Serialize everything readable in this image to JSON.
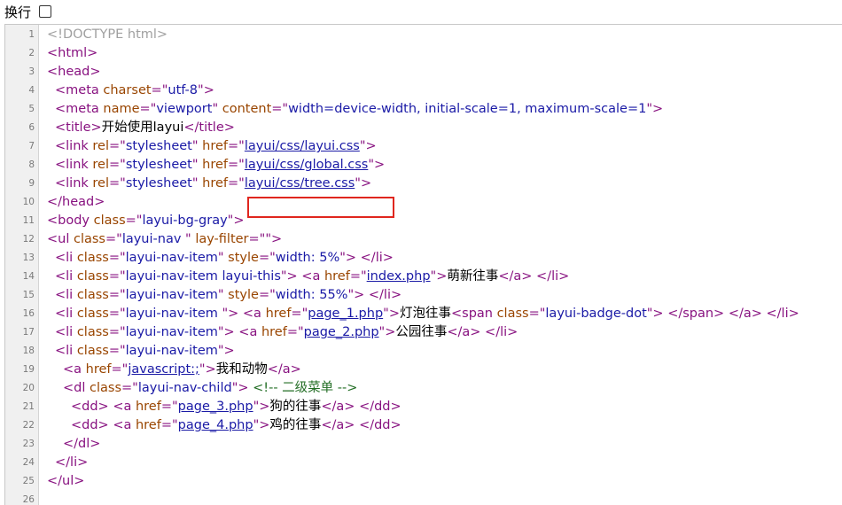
{
  "toolbar": {
    "wrap_label": "换行",
    "wrap_checked": false
  },
  "lines": [
    {
      "n": "1",
      "indent": 0,
      "parts": [
        {
          "t": "doctype",
          "v": "<!DOCTYPE html>"
        }
      ]
    },
    {
      "n": "2",
      "indent": 0,
      "parts": [
        {
          "t": "tag",
          "v": "<html>"
        }
      ]
    },
    {
      "n": "3",
      "indent": 0,
      "parts": [
        {
          "t": "tag",
          "v": "<head>"
        }
      ]
    },
    {
      "n": "4",
      "indent": 1,
      "parts": [
        {
          "t": "tag",
          "v": "<meta "
        },
        {
          "t": "attr",
          "v": "charset"
        },
        {
          "t": "tag",
          "v": "=\""
        },
        {
          "t": "val",
          "v": "utf-8"
        },
        {
          "t": "tag",
          "v": "\">"
        }
      ]
    },
    {
      "n": "5",
      "indent": 1,
      "parts": [
        {
          "t": "tag",
          "v": "<meta "
        },
        {
          "t": "attr",
          "v": "name"
        },
        {
          "t": "tag",
          "v": "=\""
        },
        {
          "t": "val",
          "v": "viewport"
        },
        {
          "t": "tag",
          "v": "\" "
        },
        {
          "t": "attr",
          "v": "content"
        },
        {
          "t": "tag",
          "v": "=\""
        },
        {
          "t": "val",
          "v": "width=device-width, initial-scale=1, maximum-scale=1"
        },
        {
          "t": "tag",
          "v": "\">"
        }
      ]
    },
    {
      "n": "6",
      "indent": 1,
      "parts": [
        {
          "t": "tag",
          "v": "<title>"
        },
        {
          "t": "text",
          "v": "开始使用layui"
        },
        {
          "t": "tag",
          "v": "</title>"
        }
      ]
    },
    {
      "n": "7",
      "indent": 1,
      "parts": [
        {
          "t": "tag",
          "v": "<link "
        },
        {
          "t": "attr",
          "v": "rel"
        },
        {
          "t": "tag",
          "v": "=\""
        },
        {
          "t": "val",
          "v": "stylesheet"
        },
        {
          "t": "tag",
          "v": "\" "
        },
        {
          "t": "attr",
          "v": "href"
        },
        {
          "t": "tag",
          "v": "=\""
        },
        {
          "t": "link",
          "v": "layui/css/layui.css"
        },
        {
          "t": "tag",
          "v": "\">"
        }
      ]
    },
    {
      "n": "8",
      "indent": 1,
      "parts": [
        {
          "t": "tag",
          "v": "<link "
        },
        {
          "t": "attr",
          "v": "rel"
        },
        {
          "t": "tag",
          "v": "=\""
        },
        {
          "t": "val",
          "v": "stylesheet"
        },
        {
          "t": "tag",
          "v": "\" "
        },
        {
          "t": "attr",
          "v": "href"
        },
        {
          "t": "tag",
          "v": "=\""
        },
        {
          "t": "link",
          "v": "layui/css/global.css"
        },
        {
          "t": "tag",
          "v": "\">"
        }
      ]
    },
    {
      "n": "9",
      "indent": 1,
      "parts": [
        {
          "t": "tag",
          "v": "<link "
        },
        {
          "t": "attr",
          "v": "rel"
        },
        {
          "t": "tag",
          "v": "=\""
        },
        {
          "t": "val",
          "v": "stylesheet"
        },
        {
          "t": "tag",
          "v": "\" "
        },
        {
          "t": "attr",
          "v": "href"
        },
        {
          "t": "tag",
          "v": "=\""
        },
        {
          "t": "link",
          "v": "layui/css/tree.css"
        },
        {
          "t": "tag",
          "v": "\">"
        }
      ]
    },
    {
      "n": "10",
      "indent": 0,
      "parts": [
        {
          "t": "tag",
          "v": "</head>"
        }
      ]
    },
    {
      "n": "11",
      "indent": 0,
      "parts": [
        {
          "t": "tag",
          "v": "<body "
        },
        {
          "t": "attr",
          "v": "class"
        },
        {
          "t": "tag",
          "v": "=\""
        },
        {
          "t": "val",
          "v": "layui-bg-gray"
        },
        {
          "t": "tag",
          "v": "\">"
        }
      ]
    },
    {
      "n": "12",
      "indent": 0,
      "parts": [
        {
          "t": "tag",
          "v": "<ul "
        },
        {
          "t": "attr",
          "v": "class"
        },
        {
          "t": "tag",
          "v": "=\""
        },
        {
          "t": "val",
          "v": "layui-nav "
        },
        {
          "t": "tag",
          "v": "\" "
        },
        {
          "t": "attr",
          "v": "lay-filter"
        },
        {
          "t": "tag",
          "v": "=\"\">"
        }
      ]
    },
    {
      "n": "13",
      "indent": 1,
      "parts": [
        {
          "t": "tag",
          "v": "<li "
        },
        {
          "t": "attr",
          "v": "class"
        },
        {
          "t": "tag",
          "v": "=\""
        },
        {
          "t": "val",
          "v": "layui-nav-item"
        },
        {
          "t": "tag",
          "v": "\" "
        },
        {
          "t": "attr",
          "v": "style"
        },
        {
          "t": "tag",
          "v": "=\""
        },
        {
          "t": "val",
          "v": "width: 5%"
        },
        {
          "t": "tag",
          "v": "\"> </li>"
        }
      ]
    },
    {
      "n": "14",
      "indent": 1,
      "parts": [
        {
          "t": "tag",
          "v": "<li "
        },
        {
          "t": "attr",
          "v": "class"
        },
        {
          "t": "tag",
          "v": "=\""
        },
        {
          "t": "val",
          "v": "layui-nav-item layui-this"
        },
        {
          "t": "tag",
          "v": "\"> <a "
        },
        {
          "t": "attr",
          "v": "href"
        },
        {
          "t": "tag",
          "v": "=\""
        },
        {
          "t": "link",
          "v": "index.php"
        },
        {
          "t": "tag",
          "v": "\">"
        },
        {
          "t": "text",
          "v": "萌新往事"
        },
        {
          "t": "tag",
          "v": "</a> </li>"
        }
      ]
    },
    {
      "n": "15",
      "indent": 1,
      "parts": [
        {
          "t": "tag",
          "v": "<li "
        },
        {
          "t": "attr",
          "v": "class"
        },
        {
          "t": "tag",
          "v": "=\""
        },
        {
          "t": "val",
          "v": "layui-nav-item"
        },
        {
          "t": "tag",
          "v": "\" "
        },
        {
          "t": "attr",
          "v": "style"
        },
        {
          "t": "tag",
          "v": "=\""
        },
        {
          "t": "val",
          "v": "width: 55%"
        },
        {
          "t": "tag",
          "v": "\"> </li>"
        }
      ]
    },
    {
      "n": "16",
      "indent": 1,
      "parts": [
        {
          "t": "tag",
          "v": "<li "
        },
        {
          "t": "attr",
          "v": "class"
        },
        {
          "t": "tag",
          "v": "=\""
        },
        {
          "t": "val",
          "v": "layui-nav-item "
        },
        {
          "t": "tag",
          "v": "\"> <a "
        },
        {
          "t": "attr",
          "v": "href"
        },
        {
          "t": "tag",
          "v": "=\""
        },
        {
          "t": "link",
          "v": "page_1.php"
        },
        {
          "t": "tag",
          "v": "\">"
        },
        {
          "t": "text",
          "v": "灯泡往事"
        },
        {
          "t": "tag",
          "v": "<span "
        },
        {
          "t": "attr",
          "v": "class"
        },
        {
          "t": "tag",
          "v": "=\""
        },
        {
          "t": "val",
          "v": "layui-badge-dot"
        },
        {
          "t": "tag",
          "v": "\"> </span> </a> </li>"
        }
      ]
    },
    {
      "n": "17",
      "indent": 1,
      "parts": [
        {
          "t": "tag",
          "v": "<li "
        },
        {
          "t": "attr",
          "v": "class"
        },
        {
          "t": "tag",
          "v": "=\""
        },
        {
          "t": "val",
          "v": "layui-nav-item"
        },
        {
          "t": "tag",
          "v": "\"> <a "
        },
        {
          "t": "attr",
          "v": "href"
        },
        {
          "t": "tag",
          "v": "=\""
        },
        {
          "t": "link",
          "v": "page_2.php"
        },
        {
          "t": "tag",
          "v": "\">"
        },
        {
          "t": "text",
          "v": "公园往事"
        },
        {
          "t": "tag",
          "v": "</a> </li>"
        }
      ]
    },
    {
      "n": "18",
      "indent": 1,
      "parts": [
        {
          "t": "tag",
          "v": "<li "
        },
        {
          "t": "attr",
          "v": "class"
        },
        {
          "t": "tag",
          "v": "=\""
        },
        {
          "t": "val",
          "v": "layui-nav-item"
        },
        {
          "t": "tag",
          "v": "\">"
        }
      ]
    },
    {
      "n": "19",
      "indent": 2,
      "parts": [
        {
          "t": "tag",
          "v": "<a "
        },
        {
          "t": "attr",
          "v": "href"
        },
        {
          "t": "tag",
          "v": "=\""
        },
        {
          "t": "link",
          "v": "javascript:;"
        },
        {
          "t": "tag",
          "v": "\">"
        },
        {
          "t": "text",
          "v": "我和动物"
        },
        {
          "t": "tag",
          "v": "</a>"
        }
      ]
    },
    {
      "n": "20",
      "indent": 2,
      "parts": [
        {
          "t": "tag",
          "v": "<dl "
        },
        {
          "t": "attr",
          "v": "class"
        },
        {
          "t": "tag",
          "v": "=\""
        },
        {
          "t": "val",
          "v": "layui-nav-child"
        },
        {
          "t": "tag",
          "v": "\"> "
        },
        {
          "t": "comment",
          "v": "<!-- 二级菜单 -->"
        }
      ]
    },
    {
      "n": "21",
      "indent": 3,
      "parts": [
        {
          "t": "tag",
          "v": "<dd> <a "
        },
        {
          "t": "attr",
          "v": "href"
        },
        {
          "t": "tag",
          "v": "=\""
        },
        {
          "t": "link",
          "v": "page_3.php"
        },
        {
          "t": "tag",
          "v": "\">"
        },
        {
          "t": "text",
          "v": "狗的往事"
        },
        {
          "t": "tag",
          "v": "</a> </dd>"
        }
      ]
    },
    {
      "n": "22",
      "indent": 3,
      "parts": [
        {
          "t": "tag",
          "v": "<dd> <a "
        },
        {
          "t": "attr",
          "v": "href"
        },
        {
          "t": "tag",
          "v": "=\""
        },
        {
          "t": "link",
          "v": "page_4.php"
        },
        {
          "t": "tag",
          "v": "\">"
        },
        {
          "t": "text",
          "v": "鸡的往事"
        },
        {
          "t": "tag",
          "v": "</a> </dd>"
        }
      ]
    },
    {
      "n": "23",
      "indent": 2,
      "parts": [
        {
          "t": "tag",
          "v": "</dl>"
        }
      ]
    },
    {
      "n": "24",
      "indent": 1,
      "parts": [
        {
          "t": "tag",
          "v": "</li>"
        }
      ]
    },
    {
      "n": "25",
      "indent": 0,
      "parts": [
        {
          "t": "tag",
          "v": "</ul>"
        }
      ]
    },
    {
      "n": "26",
      "indent": 0,
      "parts": []
    }
  ],
  "highlight": {
    "line": "9",
    "color": "#e0261e"
  },
  "colors": {
    "tag": "#881280",
    "attr": "#994500",
    "value": "#1a1aa6",
    "link": "#1a1aa6",
    "comment": "#236e25",
    "doctype": "#a0a0a0"
  }
}
